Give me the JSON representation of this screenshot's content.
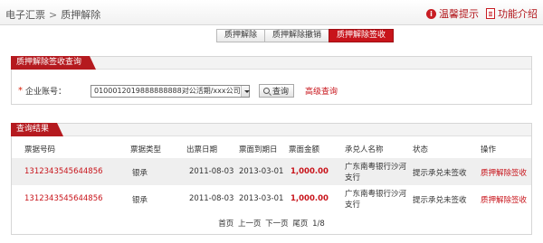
{
  "header": {
    "breadcrumb_root": "电子汇票",
    "breadcrumb_sep": ">",
    "breadcrumb_current": "质押解除",
    "help_label": "温馨提示",
    "intro_label": "功能介绍"
  },
  "tabs": [
    "质押解除",
    "质押解除撤销",
    "质押解除签收"
  ],
  "active_tab": 2,
  "query": {
    "title": "质押解除签收查询",
    "required_mark": "*",
    "account_label": "企业账号：",
    "account_value": "0100012019888888888对公活期/xxx公司",
    "search_label": "查询",
    "advanced_label": "高级查询"
  },
  "results": {
    "title": "查询结果",
    "columns": [
      "票据号码",
      "票据类型",
      "出票日期",
      "票面到期日",
      "票面金额",
      "承兑人名称",
      "状态",
      "操作"
    ],
    "rows": [
      {
        "bill_no": "1312343545644856",
        "type": "银承",
        "issue_date": "2011-08-03",
        "due_date": "2013-03-01",
        "amount": "1,000.00",
        "acceptor_line1": "广东南粤银行沙河",
        "acceptor_line2": "支行",
        "status": "提示承兑未签收",
        "action": "质押解除签收"
      },
      {
        "bill_no": "1312343545644856",
        "type": "银承",
        "issue_date": "2011-08-03",
        "due_date": "2013-03-01",
        "amount": "1,000.00",
        "acceptor_line1": "广东南粤银行沙河",
        "acceptor_line2": "支行",
        "status": "提示承兑未签收",
        "action": "质押解除签收"
      }
    ]
  },
  "pager": {
    "first": "首页",
    "prev": "上一页",
    "next": "下一页",
    "last": "尾页",
    "page_info": "1/8"
  },
  "colors": {
    "accent": "#c8141b",
    "panel_title_bg": "#b51a1f",
    "row_alt_bg": "#efefef"
  },
  "icons": {
    "help": "info-circle-icon",
    "intro": "document-icon",
    "search": "search-icon",
    "dropdown": "chevron-down-icon"
  }
}
